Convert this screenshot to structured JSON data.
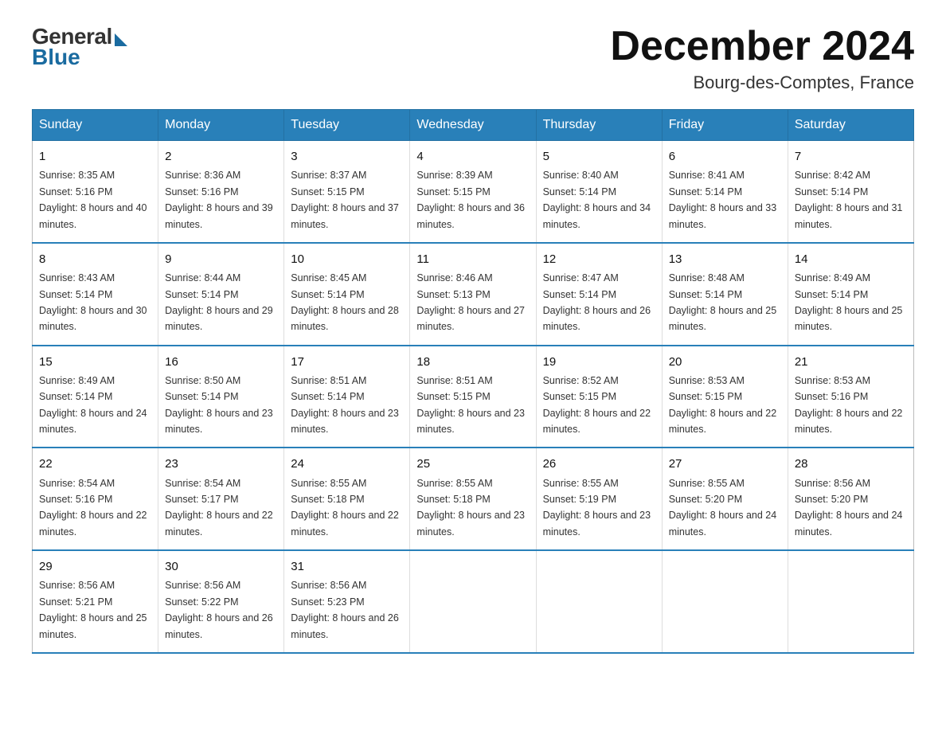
{
  "logo": {
    "general": "General",
    "blue": "Blue"
  },
  "title": "December 2024",
  "location": "Bourg-des-Comptes, France",
  "days_of_week": [
    "Sunday",
    "Monday",
    "Tuesday",
    "Wednesday",
    "Thursday",
    "Friday",
    "Saturday"
  ],
  "weeks": [
    [
      {
        "day": "1",
        "sunrise": "8:35 AM",
        "sunset": "5:16 PM",
        "daylight": "8 hours and 40 minutes."
      },
      {
        "day": "2",
        "sunrise": "8:36 AM",
        "sunset": "5:16 PM",
        "daylight": "8 hours and 39 minutes."
      },
      {
        "day": "3",
        "sunrise": "8:37 AM",
        "sunset": "5:15 PM",
        "daylight": "8 hours and 37 minutes."
      },
      {
        "day": "4",
        "sunrise": "8:39 AM",
        "sunset": "5:15 PM",
        "daylight": "8 hours and 36 minutes."
      },
      {
        "day": "5",
        "sunrise": "8:40 AM",
        "sunset": "5:14 PM",
        "daylight": "8 hours and 34 minutes."
      },
      {
        "day": "6",
        "sunrise": "8:41 AM",
        "sunset": "5:14 PM",
        "daylight": "8 hours and 33 minutes."
      },
      {
        "day": "7",
        "sunrise": "8:42 AM",
        "sunset": "5:14 PM",
        "daylight": "8 hours and 31 minutes."
      }
    ],
    [
      {
        "day": "8",
        "sunrise": "8:43 AM",
        "sunset": "5:14 PM",
        "daylight": "8 hours and 30 minutes."
      },
      {
        "day": "9",
        "sunrise": "8:44 AM",
        "sunset": "5:14 PM",
        "daylight": "8 hours and 29 minutes."
      },
      {
        "day": "10",
        "sunrise": "8:45 AM",
        "sunset": "5:14 PM",
        "daylight": "8 hours and 28 minutes."
      },
      {
        "day": "11",
        "sunrise": "8:46 AM",
        "sunset": "5:13 PM",
        "daylight": "8 hours and 27 minutes."
      },
      {
        "day": "12",
        "sunrise": "8:47 AM",
        "sunset": "5:14 PM",
        "daylight": "8 hours and 26 minutes."
      },
      {
        "day": "13",
        "sunrise": "8:48 AM",
        "sunset": "5:14 PM",
        "daylight": "8 hours and 25 minutes."
      },
      {
        "day": "14",
        "sunrise": "8:49 AM",
        "sunset": "5:14 PM",
        "daylight": "8 hours and 25 minutes."
      }
    ],
    [
      {
        "day": "15",
        "sunrise": "8:49 AM",
        "sunset": "5:14 PM",
        "daylight": "8 hours and 24 minutes."
      },
      {
        "day": "16",
        "sunrise": "8:50 AM",
        "sunset": "5:14 PM",
        "daylight": "8 hours and 23 minutes."
      },
      {
        "day": "17",
        "sunrise": "8:51 AM",
        "sunset": "5:14 PM",
        "daylight": "8 hours and 23 minutes."
      },
      {
        "day": "18",
        "sunrise": "8:51 AM",
        "sunset": "5:15 PM",
        "daylight": "8 hours and 23 minutes."
      },
      {
        "day": "19",
        "sunrise": "8:52 AM",
        "sunset": "5:15 PM",
        "daylight": "8 hours and 22 minutes."
      },
      {
        "day": "20",
        "sunrise": "8:53 AM",
        "sunset": "5:15 PM",
        "daylight": "8 hours and 22 minutes."
      },
      {
        "day": "21",
        "sunrise": "8:53 AM",
        "sunset": "5:16 PM",
        "daylight": "8 hours and 22 minutes."
      }
    ],
    [
      {
        "day": "22",
        "sunrise": "8:54 AM",
        "sunset": "5:16 PM",
        "daylight": "8 hours and 22 minutes."
      },
      {
        "day": "23",
        "sunrise": "8:54 AM",
        "sunset": "5:17 PM",
        "daylight": "8 hours and 22 minutes."
      },
      {
        "day": "24",
        "sunrise": "8:55 AM",
        "sunset": "5:18 PM",
        "daylight": "8 hours and 22 minutes."
      },
      {
        "day": "25",
        "sunrise": "8:55 AM",
        "sunset": "5:18 PM",
        "daylight": "8 hours and 23 minutes."
      },
      {
        "day": "26",
        "sunrise": "8:55 AM",
        "sunset": "5:19 PM",
        "daylight": "8 hours and 23 minutes."
      },
      {
        "day": "27",
        "sunrise": "8:55 AM",
        "sunset": "5:20 PM",
        "daylight": "8 hours and 24 minutes."
      },
      {
        "day": "28",
        "sunrise": "8:56 AM",
        "sunset": "5:20 PM",
        "daylight": "8 hours and 24 minutes."
      }
    ],
    [
      {
        "day": "29",
        "sunrise": "8:56 AM",
        "sunset": "5:21 PM",
        "daylight": "8 hours and 25 minutes."
      },
      {
        "day": "30",
        "sunrise": "8:56 AM",
        "sunset": "5:22 PM",
        "daylight": "8 hours and 26 minutes."
      },
      {
        "day": "31",
        "sunrise": "8:56 AM",
        "sunset": "5:23 PM",
        "daylight": "8 hours and 26 minutes."
      },
      null,
      null,
      null,
      null
    ]
  ]
}
